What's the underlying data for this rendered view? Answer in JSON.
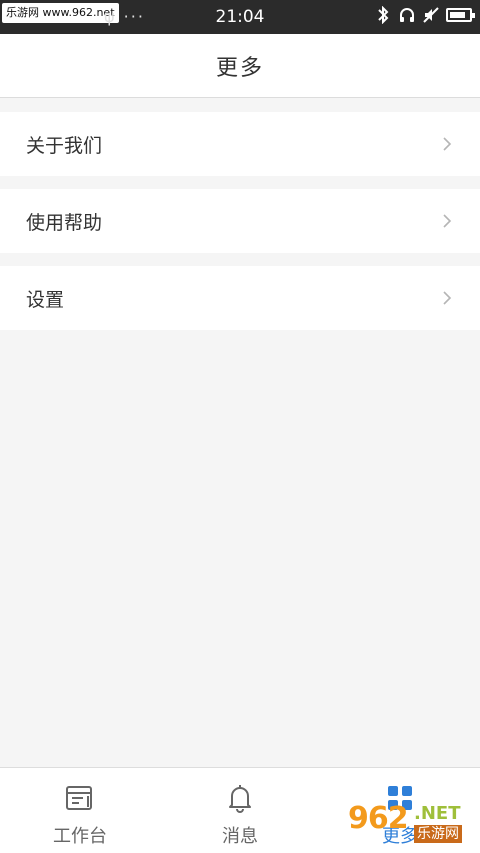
{
  "status_bar": {
    "watermark": "乐游网 www.962.net",
    "left_icons": "ψ ···",
    "time": "21:04",
    "battery_level": 0.85
  },
  "header": {
    "title": "更多"
  },
  "menu": {
    "items": [
      {
        "label": "关于我们"
      },
      {
        "label": "使用帮助"
      },
      {
        "label": "设置"
      }
    ]
  },
  "tabbar": {
    "tabs": [
      {
        "label": "工作台",
        "icon": "workbench-icon"
      },
      {
        "label": "消息",
        "icon": "bell-icon"
      },
      {
        "label": "更多",
        "icon": "grid-icon",
        "active": true
      }
    ]
  },
  "watermark_br": {
    "num": "962",
    "net": ".NET",
    "sub": "乐游网"
  },
  "colors": {
    "accent": "#2f7fd8",
    "status_bar": "#2b2b2b",
    "page_bg": "#f5f5f5"
  }
}
